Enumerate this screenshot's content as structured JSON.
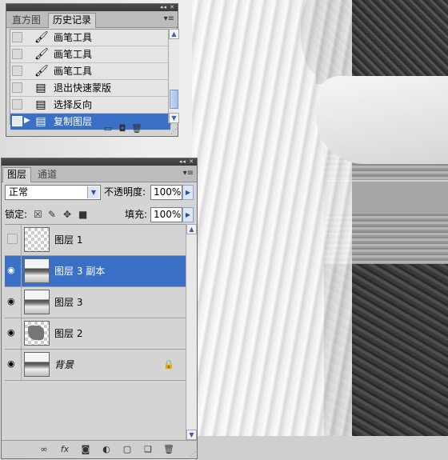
{
  "history": {
    "tabs": [
      {
        "label": "直方图",
        "active": false
      },
      {
        "label": "历史记录",
        "active": true
      }
    ],
    "items": [
      {
        "label": "画笔工具",
        "icon": "brush-icon",
        "selected": false
      },
      {
        "label": "画笔工具",
        "icon": "brush-icon",
        "selected": false
      },
      {
        "label": "画笔工具",
        "icon": "brush-icon",
        "selected": false
      },
      {
        "label": "退出快速蒙版",
        "icon": "history-state-icon",
        "selected": false
      },
      {
        "label": "选择反向",
        "icon": "history-state-icon",
        "selected": false
      },
      {
        "label": "复制图层",
        "icon": "history-state-icon",
        "selected": true
      }
    ],
    "footer_icons": [
      "new-document-icon",
      "snapshot-camera-icon",
      "trash-icon"
    ]
  },
  "layers": {
    "tabs": [
      {
        "label": "图层",
        "active": true
      },
      {
        "label": "通道",
        "active": false
      }
    ],
    "blend_mode": "正常",
    "opacity_label": "不透明度:",
    "opacity_value": "100%",
    "lock_label": "锁定:",
    "fill_label": "填充:",
    "fill_value": "100%",
    "items": [
      {
        "name": "图层 1",
        "visible": false,
        "thumb": "transparent",
        "selected": false,
        "locked": false,
        "italic": false
      },
      {
        "name": "图层 3 副本",
        "visible": true,
        "thumb": "photo",
        "selected": true,
        "locked": false,
        "italic": false
      },
      {
        "name": "图层 3",
        "visible": true,
        "thumb": "photo",
        "selected": false,
        "locked": false,
        "italic": false
      },
      {
        "name": "图层 2",
        "visible": true,
        "thumb": "mask",
        "selected": false,
        "locked": false,
        "italic": false
      },
      {
        "name": "背景",
        "visible": true,
        "thumb": "photo",
        "selected": false,
        "locked": true,
        "italic": true
      }
    ],
    "footer_icons": [
      "link-icon",
      "fx-icon",
      "mask-icon",
      "adjustment-icon",
      "group-folder-icon",
      "new-layer-icon",
      "trash-icon"
    ]
  },
  "colors": {
    "selection": "#3a70c6",
    "panel_bg": "#d4d4d4"
  }
}
